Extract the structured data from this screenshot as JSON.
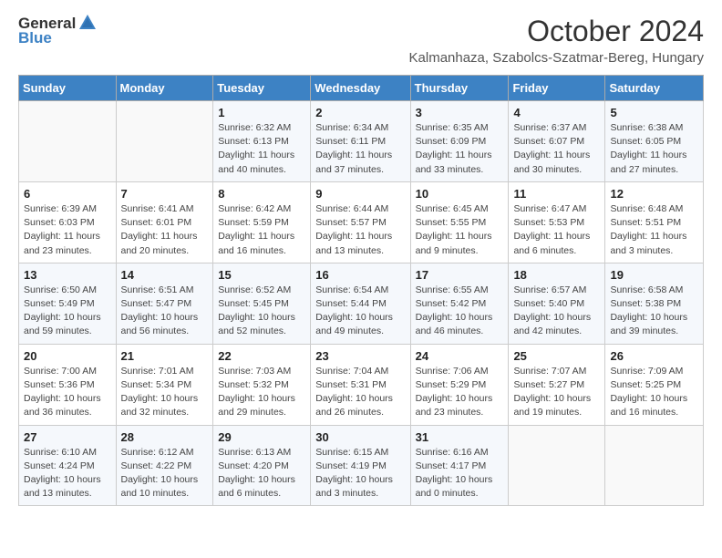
{
  "header": {
    "logo_general": "General",
    "logo_blue": "Blue",
    "month_title": "October 2024",
    "location": "Kalmanhaza, Szabolcs-Szatmar-Bereg, Hungary"
  },
  "days_of_week": [
    "Sunday",
    "Monday",
    "Tuesday",
    "Wednesday",
    "Thursday",
    "Friday",
    "Saturday"
  ],
  "weeks": [
    [
      {
        "day": "",
        "info": ""
      },
      {
        "day": "",
        "info": ""
      },
      {
        "day": "1",
        "info": "Sunrise: 6:32 AM\nSunset: 6:13 PM\nDaylight: 11 hours and 40 minutes."
      },
      {
        "day": "2",
        "info": "Sunrise: 6:34 AM\nSunset: 6:11 PM\nDaylight: 11 hours and 37 minutes."
      },
      {
        "day": "3",
        "info": "Sunrise: 6:35 AM\nSunset: 6:09 PM\nDaylight: 11 hours and 33 minutes."
      },
      {
        "day": "4",
        "info": "Sunrise: 6:37 AM\nSunset: 6:07 PM\nDaylight: 11 hours and 30 minutes."
      },
      {
        "day": "5",
        "info": "Sunrise: 6:38 AM\nSunset: 6:05 PM\nDaylight: 11 hours and 27 minutes."
      }
    ],
    [
      {
        "day": "6",
        "info": "Sunrise: 6:39 AM\nSunset: 6:03 PM\nDaylight: 11 hours and 23 minutes."
      },
      {
        "day": "7",
        "info": "Sunrise: 6:41 AM\nSunset: 6:01 PM\nDaylight: 11 hours and 20 minutes."
      },
      {
        "day": "8",
        "info": "Sunrise: 6:42 AM\nSunset: 5:59 PM\nDaylight: 11 hours and 16 minutes."
      },
      {
        "day": "9",
        "info": "Sunrise: 6:44 AM\nSunset: 5:57 PM\nDaylight: 11 hours and 13 minutes."
      },
      {
        "day": "10",
        "info": "Sunrise: 6:45 AM\nSunset: 5:55 PM\nDaylight: 11 hours and 9 minutes."
      },
      {
        "day": "11",
        "info": "Sunrise: 6:47 AM\nSunset: 5:53 PM\nDaylight: 11 hours and 6 minutes."
      },
      {
        "day": "12",
        "info": "Sunrise: 6:48 AM\nSunset: 5:51 PM\nDaylight: 11 hours and 3 minutes."
      }
    ],
    [
      {
        "day": "13",
        "info": "Sunrise: 6:50 AM\nSunset: 5:49 PM\nDaylight: 10 hours and 59 minutes."
      },
      {
        "day": "14",
        "info": "Sunrise: 6:51 AM\nSunset: 5:47 PM\nDaylight: 10 hours and 56 minutes."
      },
      {
        "day": "15",
        "info": "Sunrise: 6:52 AM\nSunset: 5:45 PM\nDaylight: 10 hours and 52 minutes."
      },
      {
        "day": "16",
        "info": "Sunrise: 6:54 AM\nSunset: 5:44 PM\nDaylight: 10 hours and 49 minutes."
      },
      {
        "day": "17",
        "info": "Sunrise: 6:55 AM\nSunset: 5:42 PM\nDaylight: 10 hours and 46 minutes."
      },
      {
        "day": "18",
        "info": "Sunrise: 6:57 AM\nSunset: 5:40 PM\nDaylight: 10 hours and 42 minutes."
      },
      {
        "day": "19",
        "info": "Sunrise: 6:58 AM\nSunset: 5:38 PM\nDaylight: 10 hours and 39 minutes."
      }
    ],
    [
      {
        "day": "20",
        "info": "Sunrise: 7:00 AM\nSunset: 5:36 PM\nDaylight: 10 hours and 36 minutes."
      },
      {
        "day": "21",
        "info": "Sunrise: 7:01 AM\nSunset: 5:34 PM\nDaylight: 10 hours and 32 minutes."
      },
      {
        "day": "22",
        "info": "Sunrise: 7:03 AM\nSunset: 5:32 PM\nDaylight: 10 hours and 29 minutes."
      },
      {
        "day": "23",
        "info": "Sunrise: 7:04 AM\nSunset: 5:31 PM\nDaylight: 10 hours and 26 minutes."
      },
      {
        "day": "24",
        "info": "Sunrise: 7:06 AM\nSunset: 5:29 PM\nDaylight: 10 hours and 23 minutes."
      },
      {
        "day": "25",
        "info": "Sunrise: 7:07 AM\nSunset: 5:27 PM\nDaylight: 10 hours and 19 minutes."
      },
      {
        "day": "26",
        "info": "Sunrise: 7:09 AM\nSunset: 5:25 PM\nDaylight: 10 hours and 16 minutes."
      }
    ],
    [
      {
        "day": "27",
        "info": "Sunrise: 6:10 AM\nSunset: 4:24 PM\nDaylight: 10 hours and 13 minutes."
      },
      {
        "day": "28",
        "info": "Sunrise: 6:12 AM\nSunset: 4:22 PM\nDaylight: 10 hours and 10 minutes."
      },
      {
        "day": "29",
        "info": "Sunrise: 6:13 AM\nSunset: 4:20 PM\nDaylight: 10 hours and 6 minutes."
      },
      {
        "day": "30",
        "info": "Sunrise: 6:15 AM\nSunset: 4:19 PM\nDaylight: 10 hours and 3 minutes."
      },
      {
        "day": "31",
        "info": "Sunrise: 6:16 AM\nSunset: 4:17 PM\nDaylight: 10 hours and 0 minutes."
      },
      {
        "day": "",
        "info": ""
      },
      {
        "day": "",
        "info": ""
      }
    ]
  ]
}
